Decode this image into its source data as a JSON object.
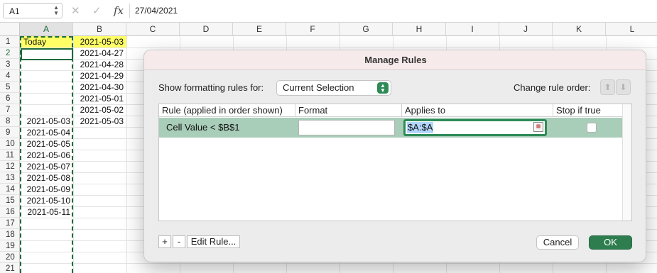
{
  "formula_bar": {
    "name_box": "A1",
    "fx_label": "fx",
    "value": "27/04/2021",
    "cancel_icon": "x-icon",
    "enter_icon": "checkmark-icon"
  },
  "sheet": {
    "columns": [
      "A",
      "B",
      "C",
      "D",
      "E",
      "F",
      "G",
      "H",
      "I",
      "J",
      "K",
      "L"
    ],
    "rows": [
      "1",
      "2",
      "3",
      "4",
      "5",
      "6",
      "7",
      "8",
      "9",
      "10",
      "11",
      "12",
      "13",
      "14",
      "15",
      "16",
      "17",
      "18",
      "19",
      "20",
      "21"
    ],
    "cells": {
      "A1": "Today",
      "B1": "2021-05-03",
      "B2": "2021-04-27",
      "B3": "2021-04-28",
      "B4": "2021-04-29",
      "B5": "2021-04-30",
      "B6": "2021-05-01",
      "B7": "2021-05-02",
      "A8": "2021-05-03",
      "B8": "2021-05-03",
      "A9": "2021-05-04",
      "A10": "2021-05-05",
      "A11": "2021-05-06",
      "A12": "2021-05-07",
      "A13": "2021-05-08",
      "A14": "2021-05-09",
      "A15": "2021-05-10",
      "A16": "2021-05-11"
    },
    "highlight_color": "#ffff66",
    "selection_color": "#1d6b3c"
  },
  "dialog": {
    "title": "Manage Rules",
    "show_rules_label": "Show formatting rules for:",
    "show_rules_value": "Current Selection",
    "change_order_label": "Change rule order:",
    "columns": {
      "rule": "Rule (applied in order shown)",
      "format": "Format",
      "applies_to": "Applies to",
      "stop_if_true": "Stop if true"
    },
    "rules": [
      {
        "rule": "Cell Value < $B$1",
        "format": "",
        "applies_to": "$A:$A",
        "stop_if_true": false
      }
    ],
    "add_label": "+",
    "remove_label": "-",
    "edit_rule_label": "Edit Rule...",
    "cancel_label": "Cancel",
    "ok_label": "OK",
    "selected_row_color": "#a8cdb8",
    "accent_color": "#2e7d4f"
  }
}
